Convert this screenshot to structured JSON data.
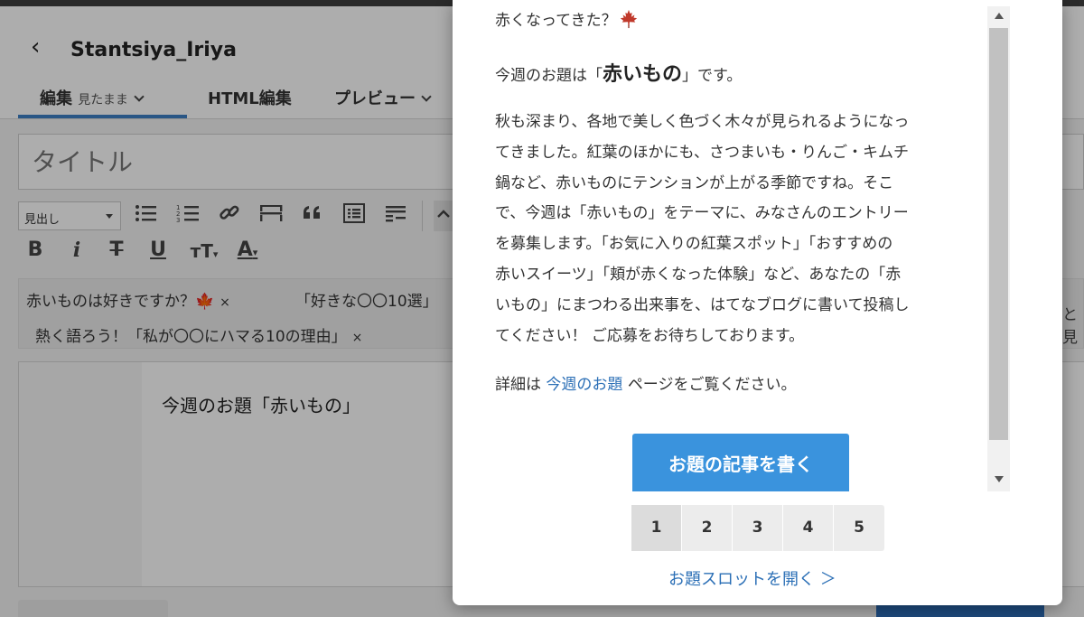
{
  "editor": {
    "blog_name": "Stantsiya_Iriya",
    "tabs": [
      {
        "label": "編集",
        "sub": "見たまま"
      },
      {
        "label": "HTML編集"
      },
      {
        "label": "プレビュー"
      }
    ],
    "title_placeholder": "タイトル",
    "toolbar": {
      "heading_select": "見出し"
    },
    "tags": [
      {
        "text": "赤いものは好きですか？🍁"
      },
      {
        "text": "「好きな〇〇10選」"
      },
      {
        "text": "熱く語ろう！「私が〇〇にハマる10の理由」"
      }
    ],
    "tag_close": "×",
    "content_line": "今週のお題「赤いもの」",
    "cut_right_text": "と見"
  },
  "modal": {
    "top_line": "赤くなってきた？",
    "theme_prefix": "今週のお題は「",
    "theme_word": "赤いもの",
    "theme_suffix": "」です。",
    "paragraph": [
      "秋も深まり、各地で美しく色づく木々が見られるようになっ",
      "てきました。紅葉のほかにも、さつまいも・りんご・キムチ",
      "鍋など、赤いものにテンションが上がる季節ですね。そこ",
      "で、今週は「赤いもの」をテーマに、みなさんのエントリー",
      "を募集します。「お気に入りの紅葉スポット」「おすすめの",
      "赤いスイーツ」「頬が赤くなった体験」など、あなたの「赤",
      "いもの」にまつわる出来事を、はてなブログに書いて投稿し",
      "てください！ ご応募をお待ちしております。"
    ],
    "detail_prefix": "詳細は",
    "detail_link": "今週のお題",
    "detail_suffix": "ページをご覧ください。",
    "write_button": "お題の記事を書く",
    "pages": [
      "1",
      "2",
      "3",
      "4",
      "5"
    ],
    "active_page": "1",
    "slot_link": "お題スロットを開く ＞"
  },
  "colors": {
    "accent_blue": "#3a93dd",
    "link_blue": "#2b6fb6",
    "leaf_red": "#c0392b"
  }
}
